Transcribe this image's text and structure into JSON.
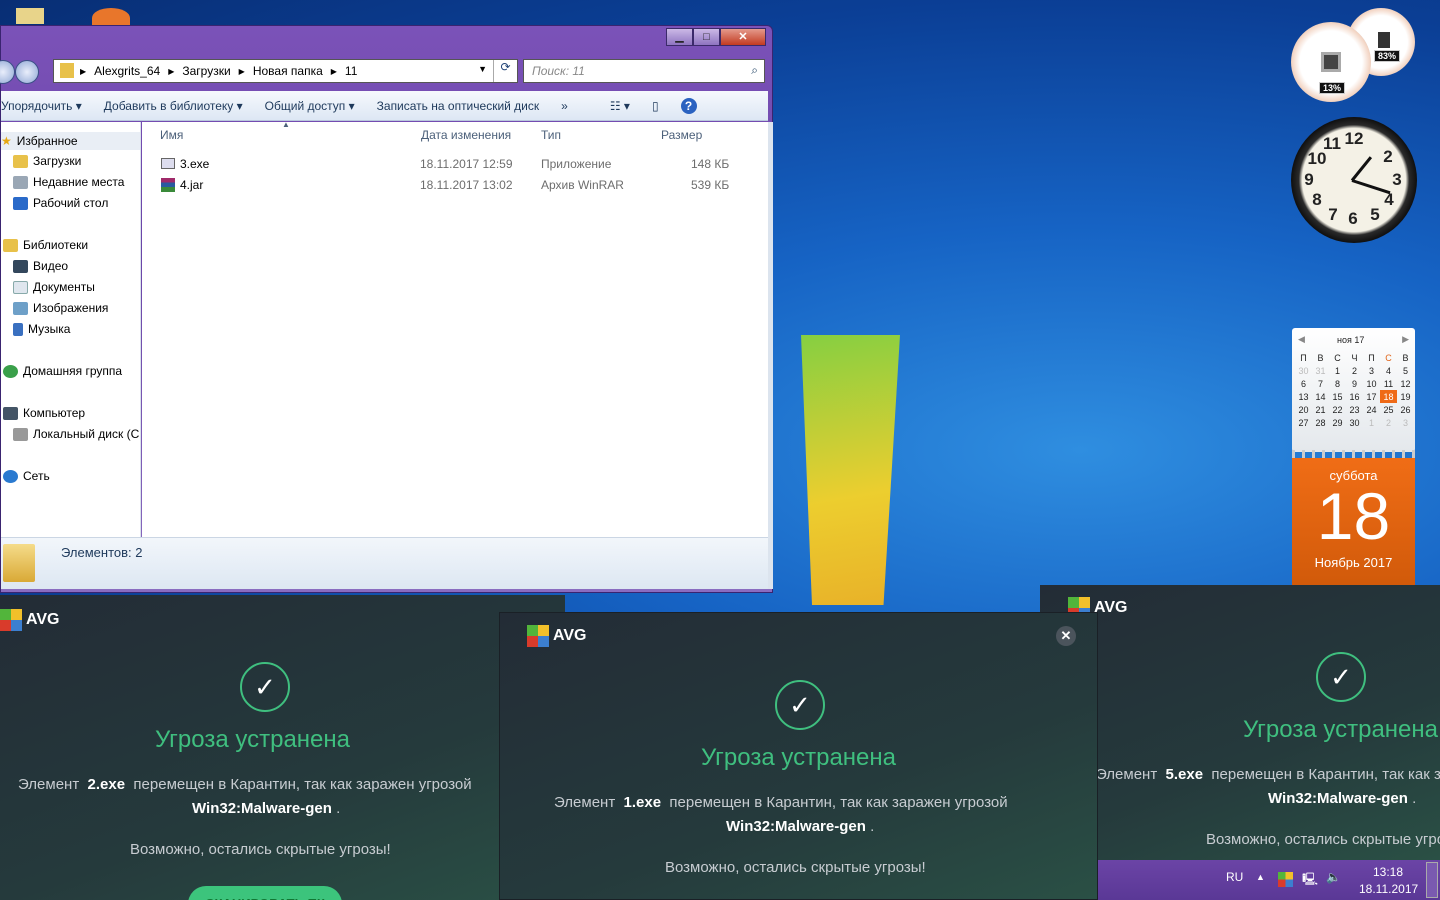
{
  "explorer": {
    "breadcrumb": [
      "Alexgrits_64",
      "Загрузки",
      "Новая папка",
      "11"
    ],
    "search_placeholder": "Поиск: 11",
    "toolbar": [
      "Упорядочить ▾",
      "Добавить в библиотеку ▾",
      "Общий доступ ▾",
      "Записать на оптический диск",
      "»"
    ],
    "nav": {
      "favorites": "Избранное",
      "downloads": "Загрузки",
      "recent": "Недавние места",
      "desktop": "Рабочий стол",
      "libraries": "Библиотеки",
      "video": "Видео",
      "documents": "Документы",
      "images": "Изображения",
      "music": "Музыка",
      "homegroup": "Домашняя группа",
      "computer": "Компьютер",
      "local_disk": "Локальный диск (С",
      "network": "Сеть"
    },
    "columns": {
      "name": "Имя",
      "date": "Дата изменения",
      "type": "Тип",
      "size": "Размер"
    },
    "files": [
      {
        "name": "3.exe",
        "date": "18.11.2017 12:59",
        "type": "Приложение",
        "size": "148 КБ"
      },
      {
        "name": "4.jar",
        "date": "18.11.2017 13:02",
        "type": "Архив WinRAR",
        "size": "539 КБ"
      }
    ],
    "status": "Элементов: 2"
  },
  "gadgets": {
    "cpu": "13%",
    "ram": "83%",
    "calendar": {
      "month": "ноя 17",
      "weekdays": [
        "П",
        "В",
        "С",
        "Ч",
        "П",
        "С",
        "В"
      ],
      "weeks": [
        [
          "30",
          "31",
          "1",
          "2",
          "3",
          "4",
          "5"
        ],
        [
          "6",
          "7",
          "8",
          "9",
          "10",
          "11",
          "12"
        ],
        [
          "13",
          "14",
          "15",
          "16",
          "17",
          "18",
          "19"
        ],
        [
          "20",
          "21",
          "22",
          "23",
          "24",
          "25",
          "26"
        ],
        [
          "27",
          "28",
          "29",
          "30",
          "1",
          "2",
          "3"
        ]
      ],
      "weekday": "суббота",
      "day": "18",
      "month_year": "Ноябрь 2017"
    }
  },
  "avg": {
    "brand": "AVG",
    "title": "Угроза устранена",
    "prefix": "Элемент",
    "middle": "перемещен в Карантин, так как заражен угрозой",
    "threat": "Win32:Malware-gen",
    "hint": "Возможно, остались скрытые угрозы!",
    "button": "СКАНИРОВАТЬ ПК",
    "files": {
      "left": "2.exe",
      "center": "1.exe",
      "right": "5.exe"
    }
  },
  "taskbar": {
    "lang": "RU",
    "time": "13:18",
    "date": "18.11.2017"
  }
}
